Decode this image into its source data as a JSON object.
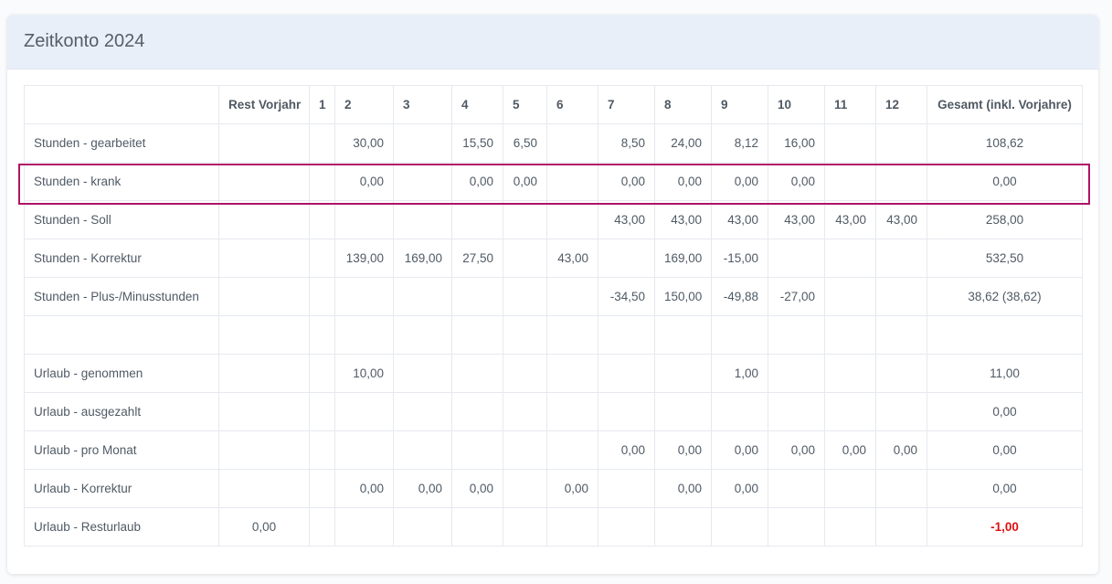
{
  "card": {
    "title": "Zeitkonto 2024"
  },
  "table": {
    "headers": [
      "",
      "Rest Vorjahr",
      "1",
      "2",
      "3",
      "4",
      "5",
      "6",
      "7",
      "8",
      "9",
      "10",
      "11",
      "12",
      "Gesamt (inkl. Vorjahre)"
    ],
    "rows": [
      [
        "Stunden - gearbeitet",
        "",
        "",
        "30,00",
        "",
        "15,50",
        "6,50",
        "",
        "8,50",
        "24,00",
        "8,12",
        "16,00",
        "",
        "",
        "108,62"
      ],
      [
        "Stunden - krank",
        "",
        "",
        "0,00",
        "",
        "0,00",
        "0,00",
        "",
        "0,00",
        "0,00",
        "0,00",
        "0,00",
        "",
        "",
        "0,00"
      ],
      [
        "Stunden - Soll",
        "",
        "",
        "",
        "",
        "",
        "",
        "",
        "43,00",
        "43,00",
        "43,00",
        "43,00",
        "43,00",
        "43,00",
        "258,00"
      ],
      [
        "Stunden - Korrektur",
        "",
        "",
        "139,00",
        "169,00",
        "27,50",
        "",
        "43,00",
        "",
        "169,00",
        "-15,00",
        "",
        "",
        "",
        "532,50"
      ],
      [
        "Stunden - Plus-/Minusstunden",
        "",
        "",
        "",
        "",
        "",
        "",
        "",
        "-34,50",
        "150,00",
        "-49,88",
        "-27,00",
        "",
        "",
        "38,62 (38,62)"
      ],
      [
        "",
        "",
        "",
        "",
        "",
        "",
        "",
        "",
        "",
        "",
        "",
        "",
        "",
        "",
        ""
      ],
      [
        "Urlaub - genommen",
        "",
        "",
        "10,00",
        "",
        "",
        "",
        "",
        "",
        "",
        "1,00",
        "",
        "",
        "",
        "11,00"
      ],
      [
        "Urlaub - ausgezahlt",
        "",
        "",
        "",
        "",
        "",
        "",
        "",
        "",
        "",
        "",
        "",
        "",
        "",
        "0,00"
      ],
      [
        "Urlaub - pro Monat",
        "",
        "",
        "",
        "",
        "",
        "",
        "",
        "0,00",
        "0,00",
        "0,00",
        "0,00",
        "0,00",
        "0,00",
        "0,00"
      ],
      [
        "Urlaub - Korrektur",
        "",
        "",
        "0,00",
        "0,00",
        "0,00",
        "",
        "0,00",
        "",
        "0,00",
        "0,00",
        "",
        "",
        "",
        "0,00"
      ],
      [
        "Urlaub - Resturlaub",
        "0,00",
        "",
        "",
        "",
        "",
        "",
        "",
        "",
        "",
        "",
        "",
        "",
        "",
        "-1,00"
      ]
    ],
    "highlighted_row_index": 1,
    "negative_total_color": "#e01010",
    "highlight_color": "#b01466"
  }
}
